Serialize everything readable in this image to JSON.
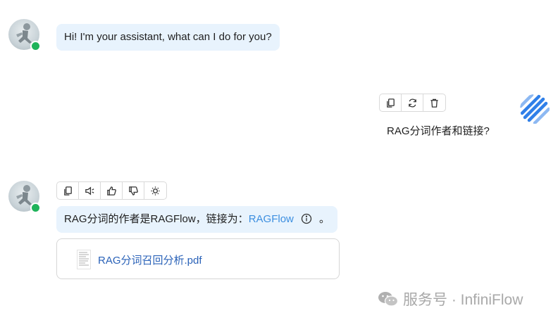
{
  "messages": {
    "assistant_greeting": "Hi! I'm your assistant, what can I do for you?",
    "user_question": "RAG分词作者和链接?",
    "assistant_answer": {
      "text_before_link": "RAG分词的作者是RAGFlow，链接为：",
      "link_text": "RAGFlow",
      "text_after_link": "。"
    },
    "document": {
      "file_name": "RAG分词召回分析.pdf"
    }
  },
  "user_toolbar": [
    "copy-icon",
    "regenerate-icon",
    "delete-icon"
  ],
  "assistant_toolbar": [
    "copy-icon",
    "speaker-icon",
    "thumbs-up-icon",
    "thumbs-down-icon",
    "lightbulb-icon"
  ],
  "watermark": {
    "text": "服务号 · InfiniFlow"
  },
  "colors": {
    "bubble_bg": "#e8f3fd",
    "online": "#1fb35a",
    "link": "#3d8fe0",
    "doc_link": "#2a62b8",
    "user_avatar": "#2f7fe8"
  }
}
